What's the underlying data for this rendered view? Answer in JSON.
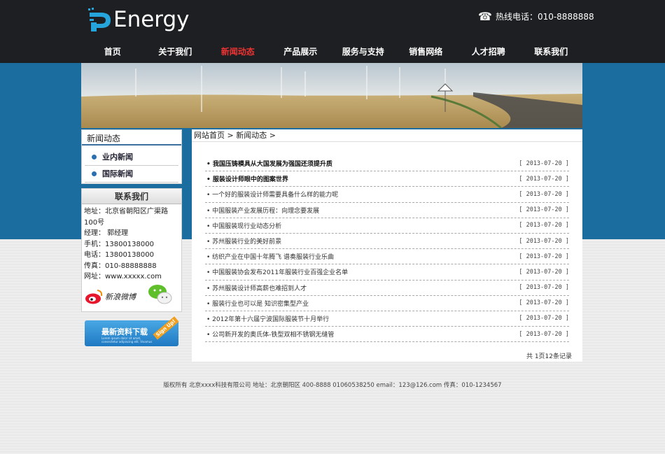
{
  "header": {
    "logo_text": "Energy",
    "hotline": "热线电话：010-8888888"
  },
  "nav": [
    {
      "label": "首页",
      "active": false
    },
    {
      "label": "关于我们",
      "active": false
    },
    {
      "label": "新闻动态",
      "active": true
    },
    {
      "label": "产品展示",
      "active": false
    },
    {
      "label": "服务与支持",
      "active": false
    },
    {
      "label": "销售网络",
      "active": false
    },
    {
      "label": "人才招聘",
      "active": false
    },
    {
      "label": "联系我们",
      "active": false
    }
  ],
  "sidebar": {
    "news_title": "新闻动态",
    "categories": [
      "业内新闻",
      "国际新闻"
    ],
    "contact_title": "联系我们",
    "contact_lines": [
      "地址：北京省朝阳区广渠路100号",
      "经理：  郭经理",
      "手机：13800138000",
      "电话：13800138000",
      "传真：010-88888888",
      "网址：www.xxxxx.com"
    ],
    "weibo_label": "新浪微博",
    "download_label": "最新资料下载",
    "download_small": "Lorem ipsum dolor sit amet, consectetur adipiscing elit. Vivamus luctus urna",
    "signup_label": "Sign Up!"
  },
  "breadcrumb": {
    "home": "网站首页",
    "current": "新闻动态"
  },
  "news": [
    {
      "title": "我国压铸模具从大国发展为强国还须提升质",
      "date": "[ 2013-07-20 ]",
      "bold": true
    },
    {
      "title": "服装设计师眼中的图案世界",
      "date": "[ 2013-07-20 ]",
      "bold": true
    },
    {
      "title": "一个好的服装设计师需要具备什么样的能力呢",
      "date": "[ 2013-07-20 ]",
      "bold": false
    },
    {
      "title": "中国服装产业发展历程：向理念要发展",
      "date": "[ 2013-07-20 ]",
      "bold": false
    },
    {
      "title": "中国服装现行业动态分析",
      "date": "[ 2013-07-20 ]",
      "bold": false
    },
    {
      "title": "苏州服装行业的美好前景",
      "date": "[ 2013-07-20 ]",
      "bold": false
    },
    {
      "title": "纺织产业在中国十年腾飞 谱奏服装行业乐曲",
      "date": "[ 2013-07-20 ]",
      "bold": false
    },
    {
      "title": "中国服装协会发布2011年服装行业百强企业名单",
      "date": "[ 2013-07-20 ]",
      "bold": false
    },
    {
      "title": "苏州服装设计师高薪也难招到人才",
      "date": "[ 2013-07-20 ]",
      "bold": false
    },
    {
      "title": "服装行业也可以是 知识密集型产业",
      "date": "[ 2013-07-20 ]",
      "bold": false
    },
    {
      "title": "2012年第十六届宁波国际服装节十月举行",
      "date": "[ 2013-07-20 ]",
      "bold": false
    },
    {
      "title": "公司新开发的奥氏体-铁型双相不锈钢无缝管",
      "date": "[ 2013-07-20 ]",
      "bold": false
    }
  ],
  "pager": "共 1页12条记录",
  "footer": "版权所有 北京xxxx科技有限公司 地址：北京朝阳区 400-8888 01060538250 email：123@126.com 传真：010-1234567",
  "colors": {
    "top": "#1e1f22",
    "band": "#1a6d9e",
    "accent": "#e33"
  }
}
